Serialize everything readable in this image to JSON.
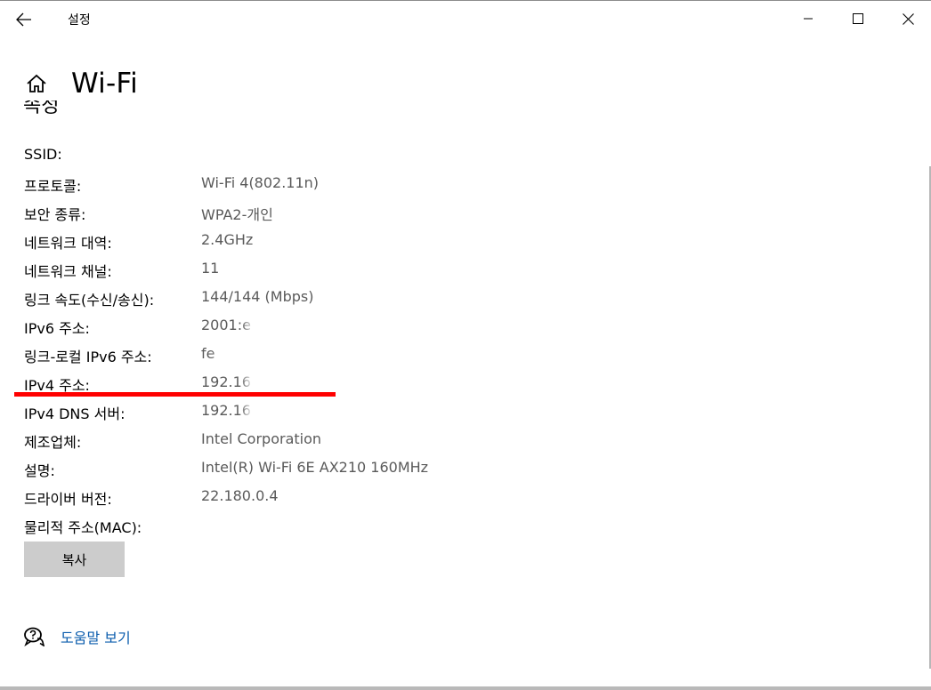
{
  "window": {
    "title": "설정"
  },
  "header": {
    "title": "Wi-Fi",
    "clipped_section": "속성"
  },
  "properties": [
    {
      "label": "SSID:",
      "value": ""
    },
    {
      "label": "프로토콜:",
      "value": "Wi-Fi 4(802.11n)"
    },
    {
      "label": "보안 종류:",
      "value": "WPA2-개인"
    },
    {
      "label": "네트워크 대역:",
      "value": "2.4GHz"
    },
    {
      "label": "네트워크 채널:",
      "value": "11"
    },
    {
      "label": "링크 속도(수신/송신):",
      "value": "144/144 (Mbps)"
    },
    {
      "label": "IPv6 주소:",
      "value": "2001:e"
    },
    {
      "label": "링크-로컬 IPv6 주소:",
      "value": "fe"
    },
    {
      "label": "IPv4 주소:",
      "value": "192.16"
    },
    {
      "label": "IPv4 DNS 서버:",
      "value": "192.16"
    },
    {
      "label": "제조업체:",
      "value": "Intel Corporation"
    },
    {
      "label": "설명:",
      "value": "Intel(R) Wi-Fi 6E AX210 160MHz"
    },
    {
      "label": "드라이버 버전:",
      "value": "22.180.0.4"
    },
    {
      "label": "물리적 주소(MAC):",
      "value": ""
    }
  ],
  "actions": {
    "copy_label": "복사",
    "help_label": "도움말 보기"
  },
  "colors": {
    "accent_link": "#0b5cad",
    "annotation": "#ff0000",
    "button_bg": "#cccccc"
  },
  "icons": {
    "back": "arrow-left-icon",
    "home": "home-icon",
    "help": "chat-question-icon"
  }
}
